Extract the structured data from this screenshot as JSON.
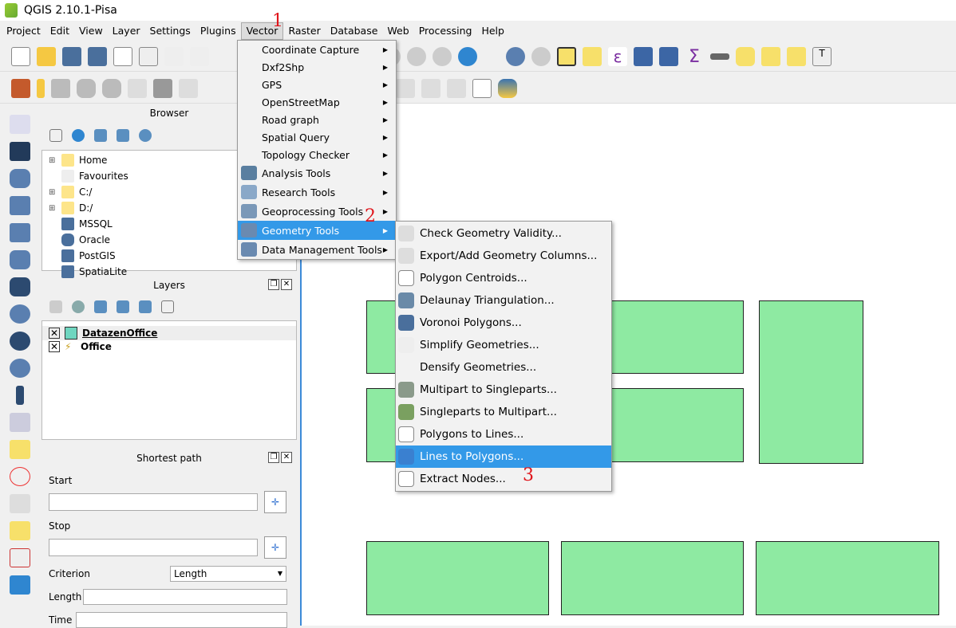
{
  "window": {
    "title": "QGIS 2.10.1-Pisa"
  },
  "menubar": [
    "Project",
    "Edit",
    "View",
    "Layer",
    "Settings",
    "Plugins",
    "Vector",
    "Raster",
    "Database",
    "Web",
    "Processing",
    "Help"
  ],
  "vector_menu": [
    {
      "label": "Coordinate Capture",
      "icon": "none"
    },
    {
      "label": "Dxf2Shp",
      "icon": "none"
    },
    {
      "label": "GPS",
      "icon": "none"
    },
    {
      "label": "OpenStreetMap",
      "icon": "none"
    },
    {
      "label": "Road graph",
      "icon": "none"
    },
    {
      "label": "Spatial Query",
      "icon": "none"
    },
    {
      "label": "Topology Checker",
      "icon": "none"
    },
    {
      "label": "Analysis Tools",
      "icon": "microscope-icon"
    },
    {
      "label": "Research Tools",
      "icon": "research-icon"
    },
    {
      "label": "Geoprocessing Tools",
      "icon": "gear-icon"
    },
    {
      "label": "Geometry Tools",
      "icon": "geometry-icon",
      "highlighted": true
    },
    {
      "label": "Data Management Tools",
      "icon": "layers-icon"
    }
  ],
  "geometry_submenu": [
    {
      "label": "Check Geometry Validity..."
    },
    {
      "label": "Export/Add Geometry Columns..."
    },
    {
      "label": "Polygon Centroids..."
    },
    {
      "label": "Delaunay Triangulation..."
    },
    {
      "label": "Voronoi Polygons..."
    },
    {
      "label": "Simplify Geometries..."
    },
    {
      "label": "Densify Geometries..."
    },
    {
      "label": "Multipart to Singleparts..."
    },
    {
      "label": "Singleparts to Multipart..."
    },
    {
      "label": "Polygons to Lines..."
    },
    {
      "label": "Lines to Polygons...",
      "highlighted": true
    },
    {
      "label": "Extract Nodes..."
    }
  ],
  "annotations": [
    "1",
    "2",
    "3"
  ],
  "browser": {
    "title": "Browser",
    "items": [
      "Home",
      "Favourites",
      "C:/",
      "D:/",
      "MSSQL",
      "Oracle",
      "PostGIS",
      "SpatiaLite"
    ]
  },
  "layers": {
    "title": "Layers",
    "items": [
      {
        "name": "DatazenOffice",
        "checked": true,
        "color": "#6fd6c0"
      },
      {
        "name": "Office",
        "checked": true
      }
    ]
  },
  "shortest_path": {
    "title": "Shortest path",
    "start_label": "Start",
    "start_value": "",
    "stop_label": "Stop",
    "stop_value": "",
    "criterion_label": "Criterion",
    "criterion_value": "Length",
    "length_label": "Length",
    "length_value": "",
    "time_label": "Time",
    "time_value": ""
  },
  "colors": {
    "polygon_fill": "#8eeaa2",
    "highlight": "#3399e8",
    "annotation": "#e0151b"
  }
}
